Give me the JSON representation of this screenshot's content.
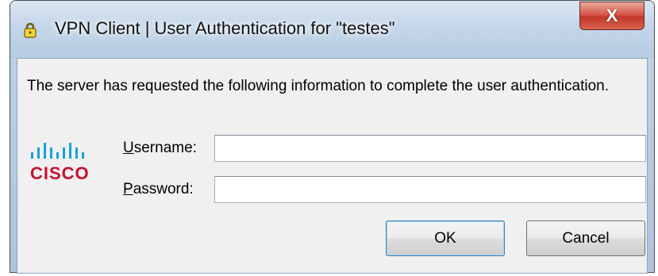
{
  "window": {
    "title": "VPN Client  |  User Authentication for \"testes\"",
    "close_glyph": "X"
  },
  "dialog": {
    "message": "The server has requested the following information to complete the user authentication.",
    "logo_text": "CISCO",
    "username": {
      "label_mnemonic": "U",
      "label_rest": "sername:",
      "value": ""
    },
    "password": {
      "label_mnemonic": "P",
      "label_rest": "assword:",
      "value": ""
    },
    "ok_label": "OK",
    "cancel_label": "Cancel"
  },
  "colors": {
    "logo_red": "#c8102e",
    "logo_blue": "#1ba0d7",
    "close_red": "#c0392b"
  },
  "icons": [
    "lock-icon",
    "close-icon",
    "cisco-logo"
  ]
}
